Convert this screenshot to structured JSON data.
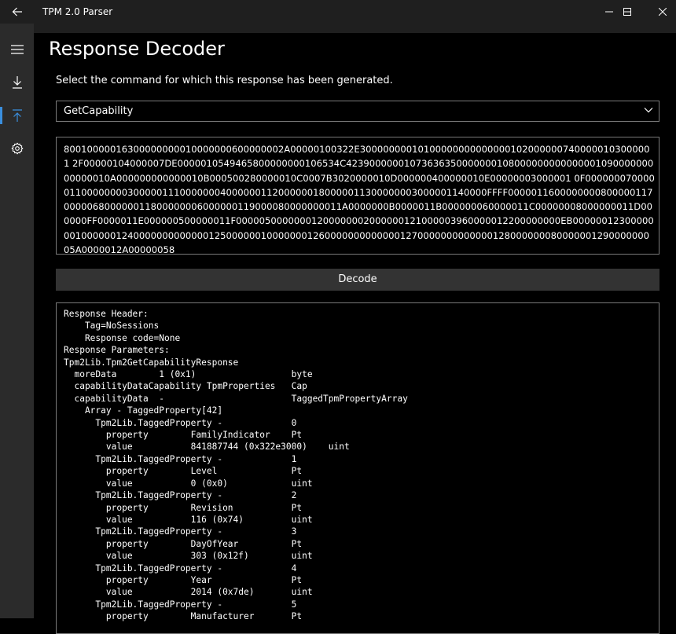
{
  "window": {
    "title": "TPM 2.0 Parser",
    "colors": {
      "titlebar": "#1f1f1f",
      "nav": "#2b2b2b",
      "accent": "#3a8fde",
      "background": "#000000"
    }
  },
  "nav": {
    "items": [
      {
        "icon": "hamburger-menu-icon"
      },
      {
        "icon": "download-icon"
      },
      {
        "icon": "upload-icon",
        "selected": true
      },
      {
        "icon": "gear-icon"
      }
    ]
  },
  "page": {
    "title": "Response Decoder",
    "instruction": "Select the command for which this response has been generated.",
    "command_selected": "GetCapability",
    "response_hex": "80010000016300000000010000000600000002A00000100322E300000000101000000000000001020000007400000103000001 2F00000104000007DE0000010549465800000000106534C4239000000107363635000000010800000000000000109000000000000010A000000000000010B000500280000010C0007B3020000010D000000400000010E00000003000001 0F0000000700000110000000030000011100000004000000112000000180000011300000003000001140000FFFF0000011600000000800000117000006800000011800000006000000119000080000000011A0000000B0000011B000000060000011C00000008000000011D000000FF0000011E000000500000011F00000500000001200000002000000121000003960000012200000000EB000000123000000010000001240000000000000125000000100000001260000000000000127000000000000012800000008000000129000000005A0000012A00000058",
    "decode_label": "Decode",
    "output_lines": [
      "Response Header:",
      "    Tag=NoSessions",
      "    Response code=None",
      "Response Parameters:",
      "Tpm2Lib.Tpm2GetCapabilityResponse",
      "  moreData        1 (0x1)                  byte",
      "  capabilityDataCapability TpmProperties   Cap",
      "  capabilityData  -                        TaggedTpmPropertyArray",
      "    Array - TaggedProperty[42]",
      "      Tpm2Lib.TaggedProperty -             0",
      "        property        FamilyIndicator    Pt",
      "        value           841887744 (0x322e3000)    uint",
      "      Tpm2Lib.TaggedProperty -             1",
      "        property        Level              Pt",
      "        value           0 (0x0)            uint",
      "      Tpm2Lib.TaggedProperty -             2",
      "        property        Revision           Pt",
      "        value           116 (0x74)         uint",
      "      Tpm2Lib.TaggedProperty -             3",
      "        property        DayOfYear          Pt",
      "        value           303 (0x12f)        uint",
      "      Tpm2Lib.TaggedProperty -             4",
      "        property        Year               Pt",
      "        value           2014 (0x7de)       uint",
      "      Tpm2Lib.TaggedProperty -             5",
      "        property        Manufacturer       Pt"
    ]
  }
}
